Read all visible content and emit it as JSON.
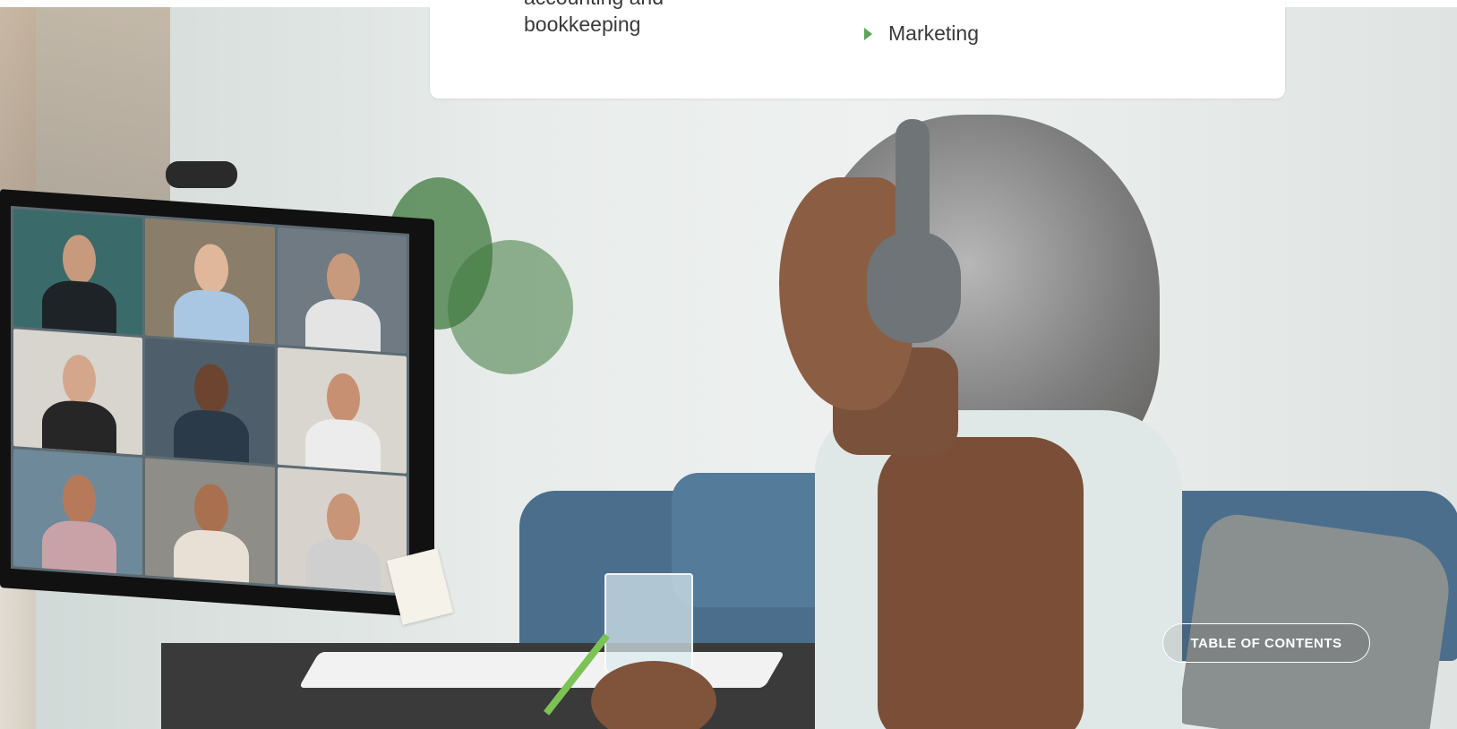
{
  "card": {
    "left_item_partial": "accounting and",
    "left_item": "bookkeeping",
    "right_item": "Marketing"
  },
  "toc_button": {
    "label": "TABLE OF CONTENTS"
  },
  "colors": {
    "bullet": "#5aa55a",
    "text": "#3a3a3a",
    "toc_border": "#ffffff"
  },
  "icons": {
    "bullet": "triangle-right-icon"
  }
}
